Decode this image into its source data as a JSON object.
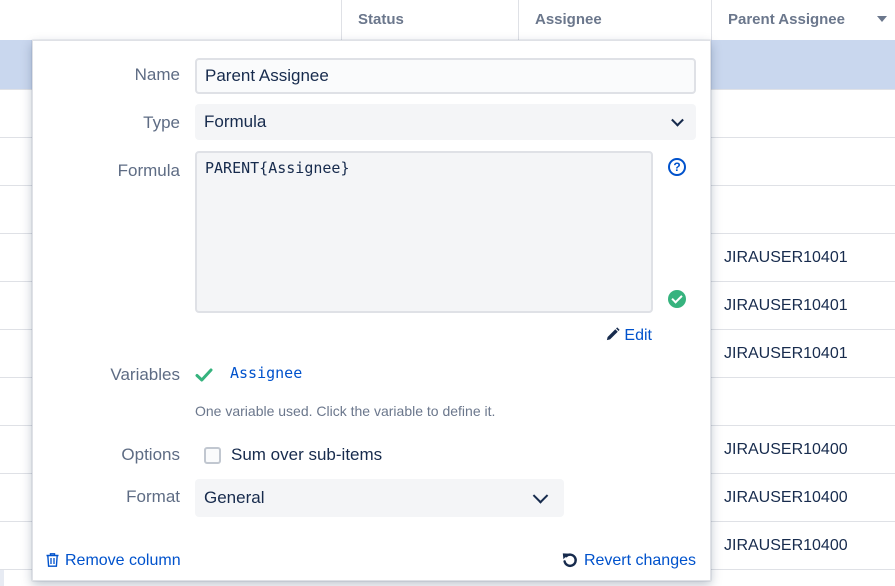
{
  "table": {
    "columns": {
      "status": "Status",
      "assignee": "Assignee",
      "parent_assignee": "Parent Assignee"
    },
    "rows": [
      {
        "parent_assignee": "",
        "selected": true
      },
      {
        "parent_assignee": ""
      },
      {
        "parent_assignee": ""
      },
      {
        "parent_assignee": ""
      },
      {
        "parent_assignee": "JIRAUSER10401"
      },
      {
        "parent_assignee": "JIRAUSER10401"
      },
      {
        "parent_assignee": "JIRAUSER10401"
      },
      {
        "parent_assignee": ""
      },
      {
        "parent_assignee": "JIRAUSER10400"
      },
      {
        "parent_assignee": "JIRAUSER10400"
      },
      {
        "parent_assignee": "JIRAUSER10400"
      }
    ]
  },
  "editor": {
    "name_label": "Name",
    "name_value": "Parent Assignee",
    "type_label": "Type",
    "type_value": "Formula",
    "formula_label": "Formula",
    "formula_value": "PARENT{Assignee}",
    "help_glyph": "?",
    "edit_label": "Edit",
    "variables_label": "Variables",
    "variable_name": "Assignee",
    "variables_hint": "One variable used. Click the variable to define it.",
    "options_label": "Options",
    "option_sum_label": "Sum over sub-items",
    "option_sum_checked": false,
    "format_label": "Format",
    "format_value": "General",
    "remove_label": "Remove column",
    "revert_label": "Revert changes"
  },
  "icons": {
    "sort": "caret-down-icon",
    "help": "help-circle-icon",
    "valid": "check-circle-icon",
    "edit": "pencil-icon",
    "variable": "check-icon",
    "remove": "trash-icon",
    "revert": "undo-icon"
  },
  "colors": {
    "accent": "#0052cc",
    "success": "#36b37e",
    "selected_row": "#c9d7ee",
    "label": "#5e6c84"
  }
}
